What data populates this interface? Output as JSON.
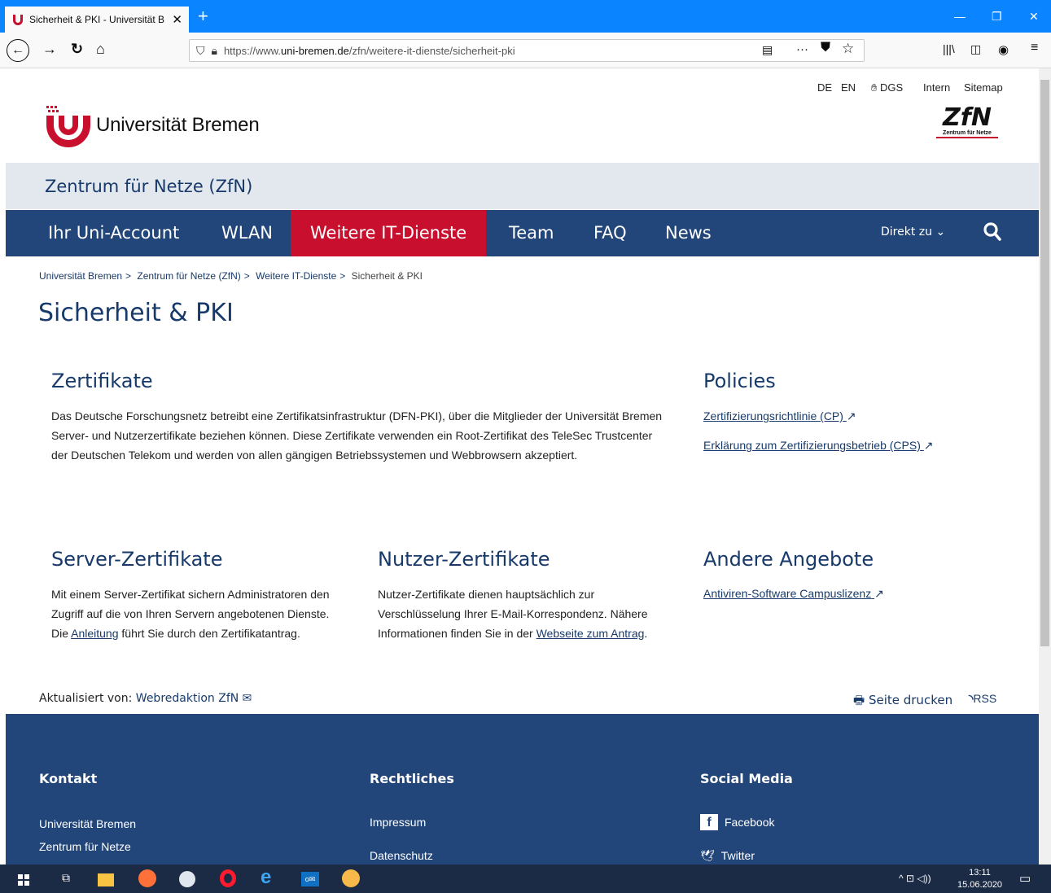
{
  "browser": {
    "tab_title": "Sicherheit & PKI - Universität B",
    "tab_close": "✕",
    "new_tab": "+",
    "url_prefix": "https://www.",
    "url_domain": "uni-bremen.de",
    "url_path": "/zfn/weitere-it-dienste/sicherheit-pki",
    "more": "···"
  },
  "header": {
    "lang_de": "DE",
    "lang_en": "EN",
    "dgs": "DGS",
    "intern": "Intern",
    "sitemap": "Sitemap",
    "uni_name": "Universität Bremen",
    "zfn_logo_text": "ZfN",
    "zfn_logo_sub": "Zentrum für Netze",
    "institute": "Zentrum für Netze (ZfN)"
  },
  "nav": {
    "items": [
      "Ihr Uni-Account",
      "WLAN",
      "Weitere IT-Dienste",
      "Team",
      "FAQ",
      "News"
    ],
    "direkt": "Direkt zu"
  },
  "breadcrumb": [
    "Universität Bremen",
    "Zentrum für Netze (ZfN)",
    "Weitere IT-Dienste",
    "Sicherheit & PKI"
  ],
  "page_title": "Sicherheit & PKI",
  "zertifikate": {
    "heading": "Zertifikate",
    "text": "Das Deutsche Forschungsnetz betreibt eine Zertifikatsinfrastruktur (DFN-PKI), über die Mitglieder der Universität Bremen Server- und Nutzerzertifikate beziehen können. Diese Zertifikate verwenden ein Root-Zertifikat des TeleSec Trustcenter der Deutschen Telekom und werden von allen gängigen Betriebssystemen und Webbrowsern akzeptiert."
  },
  "policies": {
    "heading": "Policies",
    "link1": "Zertifizierungsrichtlinie (CP)",
    "link2": "Erklärung zum Zertifizierungsbetrieb (CPS)"
  },
  "server": {
    "heading": "Server-Zertifikate",
    "text1": "Mit einem Server-Zertifikat sichern Administratoren den Zugriff auf die von Ihren Servern angebotenen Dienste. Die ",
    "link": "Anleitung",
    "text2": " führt Sie durch den Zertifikatantrag."
  },
  "nutzer": {
    "heading": "Nutzer-Zertifikate",
    "text1": "Nutzer-Zertifikate dienen hauptsächlich zur Verschlüsselung Ihrer E-Mail-Korrespondenz. Nähere Informationen finden Sie in der ",
    "link": "Webseite zum Antrag",
    "text2": "."
  },
  "andere": {
    "heading": "Andere Angebote",
    "link": "Antiviren-Software Campuslizenz"
  },
  "updated": {
    "label": "Aktualisiert von:",
    "author": "Webredaktion ZfN"
  },
  "print": "Seite drucken",
  "rss": "RSS",
  "footer": {
    "kontakt": "Kontakt",
    "kontakt_items": [
      "Universität Bremen",
      "Zentrum für Netze"
    ],
    "recht": "Rechtliches",
    "recht_items": [
      "Impressum",
      "Datenschutz"
    ],
    "social": "Social Media",
    "social_items": [
      "Facebook",
      "Twitter"
    ]
  },
  "taskbar": {
    "time": "13:11",
    "date": "15.06.2020"
  },
  "colors": {
    "brand_blue": "#22467a",
    "brand_red": "#c8102e",
    "firefox_blue": "#0a84ff"
  }
}
